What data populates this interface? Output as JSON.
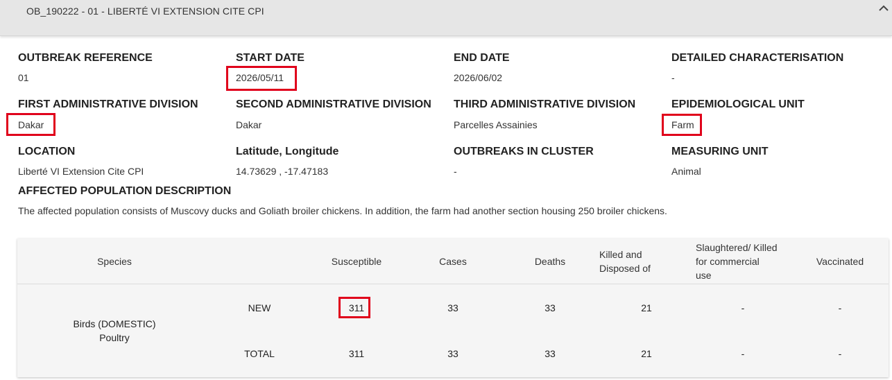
{
  "header": {
    "title": "OB_190222 - 01 - LIBERTÉ VI EXTENSION CITE CPI"
  },
  "details": {
    "outbreak_reference": {
      "label": "OUTBREAK REFERENCE",
      "value": "01"
    },
    "start_date": {
      "label": "START DATE",
      "value": "2026/05/11"
    },
    "end_date": {
      "label": "END DATE",
      "value": "2026/06/02"
    },
    "detailed_characterisation": {
      "label": "DETAILED CHARACTERISATION",
      "value": "-"
    },
    "first_admin_division": {
      "label": "FIRST ADMINISTRATIVE DIVISION",
      "value": "Dakar"
    },
    "second_admin_division": {
      "label": "SECOND ADMINISTRATIVE DIVISION",
      "value": "Dakar"
    },
    "third_admin_division": {
      "label": "THIRD ADMINISTRATIVE DIVISION",
      "value": "Parcelles Assainies"
    },
    "epidemiological_unit": {
      "label": "EPIDEMIOLOGICAL UNIT",
      "value": "Farm"
    },
    "location": {
      "label": "LOCATION",
      "value": "Liberté VI Extension Cite CPI"
    },
    "lat_long": {
      "label": "Latitude, Longitude",
      "value": "14.73629 , -17.47183"
    },
    "outbreaks_in_cluster": {
      "label": "OUTBREAKS IN CLUSTER",
      "value": "-"
    },
    "measuring_unit": {
      "label": "MEASURING UNIT",
      "value": "Animal"
    }
  },
  "affected_population": {
    "label": "AFFECTED POPULATION DESCRIPTION",
    "text": "The affected population consists of Muscovy ducks and Goliath broiler chickens. In addition, the farm had another section housing 250 broiler chickens."
  },
  "table": {
    "headers": {
      "species": "Species",
      "susceptible": "Susceptible",
      "cases": "Cases",
      "deaths": "Deaths",
      "killed_l1": "Killed and",
      "killed_l2": "Disposed of",
      "slaughtered_l1": "Slaughtered/ Killed",
      "slaughtered_l2": "for commercial",
      "slaughtered_l3": "use",
      "vaccinated": "Vaccinated"
    },
    "species_l1": "Birds (DOMESTIC)",
    "species_l2": "Poultry",
    "rows": [
      {
        "label": "NEW",
        "susceptible": "311",
        "cases": "33",
        "deaths": "33",
        "killed": "21",
        "slaughtered": "-",
        "vaccinated": "-"
      },
      {
        "label": "TOTAL",
        "susceptible": "311",
        "cases": "33",
        "deaths": "33",
        "killed": "21",
        "slaughtered": "-",
        "vaccinated": "-"
      }
    ]
  },
  "colors": {
    "highlight": "#e0001b",
    "header_bg": "#e6e6e6",
    "table_bg": "#f5f5f5"
  }
}
